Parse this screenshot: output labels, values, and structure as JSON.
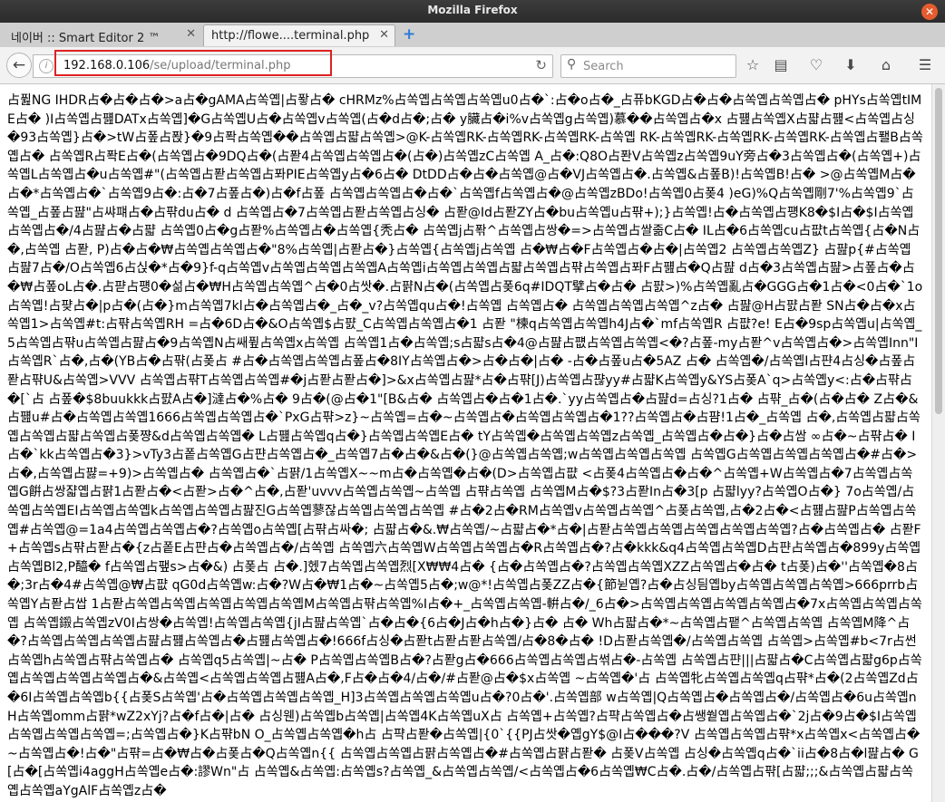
{
  "window": {
    "title": "Mozilla Firefox",
    "close_glyph": "✕"
  },
  "tabs": [
    {
      "label": "네이버 :: Smart Editor 2 ™",
      "close": "✕",
      "active": false
    },
    {
      "label": "http://flowe....terminal.php",
      "close": "✕",
      "active": true
    }
  ],
  "newtab_glyph": "+",
  "navbar": {
    "back_glyph": "←",
    "info_glyph": "i",
    "url_host": "192.168.0.106",
    "url_path": "/se/upload/terminal.php",
    "reload_glyph": "↻",
    "search_placeholder": "Search",
    "search_glyph": "⚲",
    "bookmark_glyph": "☆",
    "library_glyph": "▤",
    "pocket_glyph": "♡",
    "download_glyph": "⬇",
    "home_glyph": "⌂",
    "menu_glyph": "☰"
  },
  "colors": {
    "url_highlight": "#e02020",
    "titlebar": "#2b2b2b",
    "newtab": "#2d7bd8"
  },
  "content": {
    "lines": [
      "占퓚NG IHDR占�占�占�>a占�gAMA占쏙옙|占퐣占� cHRMz%占쏙옙占쏙옙占쏙옙u0占�`:占�o占�_占퓨bKGD占�占�占쏙옙占쏙옙占�",
      "pHYs占쏙옙tIME占� )I占쏙옙占퍮DATx占쏙옙]�G占쏙옙U占�占쏙옙v占쏙옙(占�d占�;占� y臟占�i%v占쏙옙g占쏙옙)慕��占쏙옙占�x",
      "占퍮占쏙옙X占퍏占퍮<占쏙옙占싱�93占쏙옙}占�>tW占퐆占퐍}�9占퐉占쏙옙��占쏙옙占퍏占쏙옙>@K-占쏙옙RK-占쏙옙RK-占쏙옙RK-占쏙옙",
      "RK-占쏙옙RK-占쏙옙RK-占쏙옙RK-占쏙옙占퐬B占쏙옙占� 占쏙옙R占퐉E占�(占쏙옙占�9DQ占�(占퐏4占쏙옙占쏙옙占�(占�)占쏙옙zC占쏙옙",
      "A_占�:Q8O占퐌V占쏙옙z占쏙옙9uY旁占�3占쏙옙占�(占쏙옙+)占쏙옙L占쏙옙占�u占쏙옙#\"(占쏙옙占퐏占쏙옙占퐈PIE占쏙옙y占�6占�",
      "DtDD占�占�占쏙옙@占�VJ占쏙옙占�.占쏙옙&占퐆B)!占쏙옙B!占� >@占쏙옙M占�占�*占쏙옙占�`占쏙옙9占�:占�7占퐆占�)占�f占퐆",
      "占쏙옙占쏙옙占�占�`占쏙옙f占쏙옙占�@占쏙옙zBDo!占쏙옙0占퐂4 )eG)%Q占쏙옙剛7'%占쏙옙9`占쏙옙_占퐆占퍒\"占쌰퍠占�占퍆du占� d",
      "占쏙옙占�7占쏙옙占퐏占쏙옙占싱� 占퐏@Id占퐏ZY占�bu占쏙옙u占퍆+);}占쏙옙!占�占쏙옙占퍵K8�$I占�$I占쏙옙占쏙옙占�/4占퍒占�占퍏",
      "占쏙옙0占�g占퐏%占쏙옙占�占쏙옙{秃占� 占쏙옙j占퐊^占쏙옙占쌍�=>占쏙옙占쌀졺C占� IL占�6占쏙옙cu占퍖t占쏙옙{占�N占�,占쏙옙",
      "占퐏, P)占�占�₩占쏙옙占쏙옙占�\"8%占쏙옙|占퐏占�}占쏙옙{占쏙옙j占쏙옙 占�₩占�F占쏙옙占�占�|占쏙옙2 占쏙옙占쏙옙Z} 占퍒p{#占쏙옙",
      "占퍒7占�/O占쏙옙6占싡�*占�9}f-q占쏙옙v占쏙옙占쏙옙占쏙옙A占쏙옙i占쏙옙占쏙옙占퍏占쏙옙占퍆占쏙옙占퐈F占퍮占�Q占퍒",
      "d占�3占쏙옙占퍒>占퐆占�占�₩占퐆oL占�.占퍋占퍵0�섦占�₩H占쏙옙占쏙옙^占�0占쌋�.占퍍N占�(占쏙옙占퐂6q#IDQT擘占�占�",
      "占퍐>)%占쏙옙亂占�GGG占�1占�<0占�`1o占쏙옙!占퍚占�|p占�(占�}m占쏙옙7kl占�占쏙옙占�_占�_v?占쏙옙qu占�!占쏙옙 占쏙옙占�",
      "占쏙옙占쏙옙占쏙옙^z占� 占퍒@H占퍐占퐏 SN占�占�x占쏙옙1>占쏙옙#t:占퍆占쏙옙RH =占�6D占�&O占쏙옙$占퍐_C占쏙옙占쏙옙占�1",
      "占퐏 \"楝q占쏙옙占쏙옙h4J占�`mf占쏙옙R 占퍖?e! E占�9sp占쏙옙u|占쏙옙_5占쏙옙占퍆u占쏙옙占퍒占�9占쏙옙N占쌔퓦占쏙옙x占쏙옙",
      "占쏙옙1占�占쏙옙;s占퍏s占�4@占퍒占퍲占쏙옙占쏙옙<�?占퐆-my占퐏^v占쏙옙占�>占쏙옙Inn\"I占쏙옙R`占�,占�(YB占�占퍆(占퐂占",
      "#占�占쏙옙占쏙옙占퐆占�8IY占쏙옙占�>占�占�|占� -占�占퐆u占�5AZ 占� 占쏙옙�/占쏙옙I占퍈4占싱�占퐆占퐏占퍆U&占쏙옙>VVV",
      "占쏙옙占퍆T占쏙옙占쏙옙#�j占퐏占퐏占�]>&x占쏙옙占퍒*占�占퍆[J)占쏙옙占퍊yy#占퍏K占쏙옙y&YS占퐂A`q>占쏙옙y<:占�占퍆占�[`占",
      "占퐆�$8buukkk占퍐A占�]澾占�%占� 9占�(@占�1\"[B&占� 占쏙옙占�占�1占�.`yy占쏙옙占�占퍒d=占싱?1占� 占퍆_占�(占�占�",
      "Z占�&占퍮u#占�占쏙옙占쏙옙1666占쏙옙占쏙옙占�`PxG占퍆>z}~占쏙옙=占�~占쏙옙占�占쏙옙占쏙옙占�1??占쏙옙占�占퍔!1占�_占쏙옙",
      "占�,占쏙옙占퍏占쏙옙占쏙옙占퍏占쏙옙占퐂쨩&d占쏙옙占쏙옙� L占퍮占쏙옙q占�}占쏙옙占쏙옙E占� tY占쏙옙�占쏙옙占쏙옙z占쏙옙_占쏙옙占�占�}占�占쌈",
      "∞占�~占퍆占� I占�`kk占쏙옙占�3}>vTy3占퐅占쏙옙G占퍈占쏙옙占�_占쏙옙7占�占�&占�(}@占쏙옙占쏙옙;w占쏙옙占쏙옙占쏙옙",
      "占쏙옙G占쏙옙占쏙옙占쏙옙占�#占�>占�,占쏙옙占퍓=+9)>占쏙옙占� 占쏙옙占�`占퍍/1占쏙옙X~~m占�占쏙옙�占�(D>占쏙옙占퍖",
      "<占퐂4占쏙옙占�占�^占쏙옙+W占쏙옙占�7占쏙옙占쏙옙G餠占쌍쟓옙占퍍1占퐏占�<占퐏>占�^占�,占퐏'uvvv占쏙옙占쏙옙~占쏙옙 占퍆占쏙옙",
      "占쏙옙M占�$?3占퐏In占�3[p 占퍏lyy?占쏙옙O占�} 7o占쏙옙/占쏙옙占쏙옙EI占쏙옙占쏙옙k占쏙옙占쏙옙占퍒진G占쏙옙蓼잖占쏙옙占쏙옙占쏙옙",
      "#占�2占�RM占쏙옙v占쏙옙占쏙옙^占퐂占쏙옙,占�2占�<占퍮占퍒P占쏙옙占쏙옙#占쏙옙@=1a4占쏙옙占쏙옙占�?占쏙옙o占쏙옙[占퍆占싸�;",
      "占퍏占�&.₩占쏙옙/~占퍏占�*占�|占퐏占쏙옙占쏙옙占쏙옙占쏙옙占쏙옙?占�占쏙옙占� 占퐏F+占쏙옙s占퍆占퐏占�{z占퐅E占퍈占�占쏙옙占�/占쏙옙",
      "占쏙옙六占쏙옙W占쏙옙占쏙옙占�R占쏙옙占�?占�kkk&q4占쏙옙占쏙옙D占퍈占쏙옙占�899y占쏙옙占쏙옙Bl2,P醯� f占쏙옙占퍂s>占�&) 占퐂占",
      "占�.]헸7占쏙옙占쏙옙烈[X₩₩4占� {占�占쏙옙占�?占쏙옙占쏙옙XZZ占쏙옙占�占� t占퐂)占�''占쏙옙�8占�;3r占�4#占쏙옙@₩占퍖",
      "qG0d占쏙옙w:占�?W占�₩1占�~占쏙옙5占�;w@*!占쏙옙占퐂ZZ占�{節뉟옙?占�占싱딈옙by占쏙옙占쏙옙占쏙옙>666prrb占쏙옙Y占퐏占쌉",
      "1占퐏占쏙옙占쏙옙占쏙옙占쏙옙占쏙옙M占쏙옙占퍆占쏙옙%I占�+_占쏙옙占쏙옙-輧占�/_6占�>占쏙옙占쏙옙占쏙옙占쏙옙占�7x占쏙옙占쏙옙占쏙옙",
      "占쏙옙鎩占쏙옙zV0I占쌍�占쏙옙!占쏙옙占쏙옙{jI占퍒占쏙옙`占�占�{6占�J占�h占�}占� 占� Wh占퍏占�*~占쏙옙占퍁^占쏙옙占쏙옙",
      "占쏙옙M降^占�?占쏙옙占쏙옙占쏙옙占퍒占퍮占쏙옙占�占퍮占쏙옙占�!666f占싱�占퐏t占퐏占퐏占쏙옙/占�8�占� !D占퐏占쏙옙�/占쏙옙占쏙옙",
      "占쏙옙>占쏙옙#b<7r占썬占쏙옙h占쏙옙占퍆占쏙옙占� 占쏙옙q5占쏙옙|~占� P占쏙옙占쏙옙B占�?占퐏g占�666占쏙옙占쏙옙占썪占�-占쏙옙",
      "占쏙옙占퍈|||占퍏占�C占쏙옙占퍏g6p占쏙옙占쏙옙占쏙옙占쏙옙占�&占쏙옙<占쏙옙占쏙옙占퍮A占�,F占�占�4/占�/#占퐏@占�$x占쏙옙 ~占쏙옙�'占",
      "占쏙옙牝占쏙옙占쏙옙q占퍆*占�(2占쏙옙Zd占�6I占쏙옙占쏙옙b{{占퐂S占쏙옙'占�占쏙옙占쏙옙占쏙옙_H]3占쏙옙占쏙옙占쏙옙u占�?0占�'.占쏙옙部",
      "w占쏙옙|Q占쏙옙占�占쏙옙占�/占쏙옙占�6u占쏙옙nH占쏙옙omm占퍍*wZ2xYj?占�f占�|占� 占싱웬)占쏙옙b占쏙옙|占쏙옙4K占쏙옙uX占",
      "占쏙옙+占쏙옙?占퍅占쏙옙占�占쌩쒙옙占쏙옙占�`2j占�9占�$I占쏙옙占쏙옙占쏙옙占쏙옙=;占쏙옙占�}K占퍆bN O_占쏙옙占쏙옙�h占",
      "占퍅占퐏�占쏙옙|{0`{{PJ占쌋�옙gY$@I占���?V 占쏙옙占쏙옙占퍆*x占쏙옙x<占쏙옙占�~占쏙옙占�!占�\"占퍆=占�₩占�占퐂占�Q占쏙옙n{{",
      "占쏙옙占쏙옙占퍍占쏙옙占�#占쏙옙占퍍占퐏� 占퐂V占쏙옙 占싱�占쏙옙q占�`ii占�8占�l퍒占� G[占�[占쏙옙i4aggH占쏙옙e占�:謬Wn\"占",
      "占쏙옙&占쏙옙:占쏙옙s?占쏙옙_&占쏙옙占쏙옙/<占쏙옙占�6占쏙옙₩C占�.占�/占쏙옙占퍆[占퍏;;;&占쏙옙占퍏占쏙옙占쏙옙aYgAlF占쏙옙z占�"
    ]
  }
}
